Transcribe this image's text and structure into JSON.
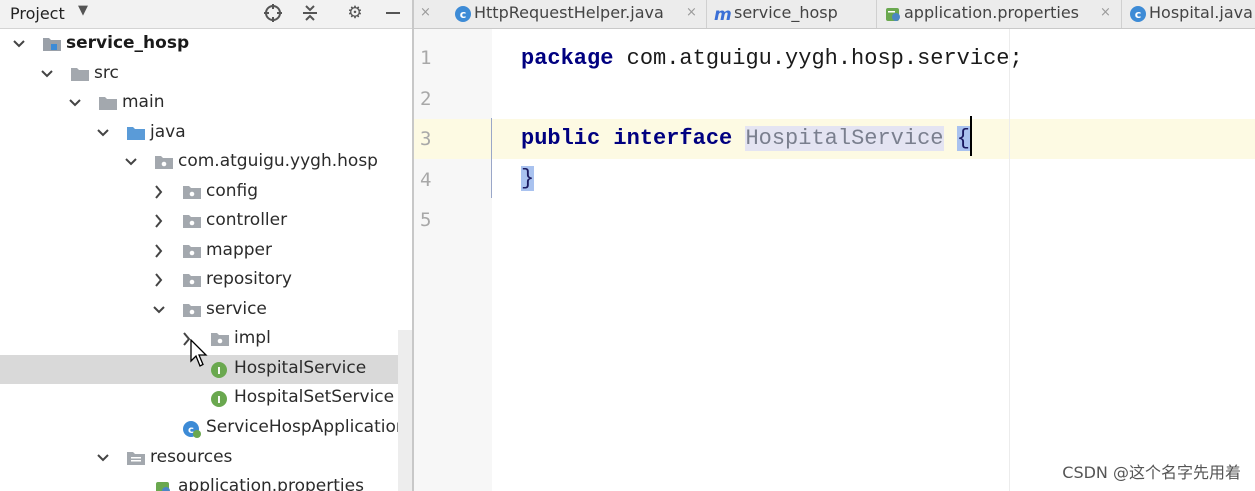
{
  "project_panel": {
    "title": "Project",
    "icons": [
      "crosshair-icon",
      "collapse-icon",
      "gear-icon",
      "minimize-icon"
    ],
    "tree": [
      {
        "label": "service_hosp",
        "icon": "module-folder-icon",
        "expanded": true,
        "bold": true
      },
      {
        "label": "src",
        "icon": "folder-icon",
        "expanded": true
      },
      {
        "label": "main",
        "icon": "folder-icon",
        "expanded": true
      },
      {
        "label": "java",
        "icon": "source-folder-icon",
        "expanded": true
      },
      {
        "label": "com.atguigu.yygh.hosp",
        "icon": "package-icon",
        "expanded": true
      },
      {
        "label": "config",
        "icon": "package-icon",
        "expanded": false
      },
      {
        "label": "controller",
        "icon": "package-icon",
        "expanded": false
      },
      {
        "label": "mapper",
        "icon": "package-icon",
        "expanded": false
      },
      {
        "label": "repository",
        "icon": "package-icon",
        "expanded": false
      },
      {
        "label": "service",
        "icon": "package-icon",
        "expanded": true
      },
      {
        "label": "impl",
        "icon": "package-icon",
        "expanded": false
      },
      {
        "label": "HospitalService",
        "icon": "interface-icon",
        "selected": true
      },
      {
        "label": "HospitalSetService",
        "icon": "interface-icon"
      },
      {
        "label": "ServiceHospApplication",
        "icon": "spring-boot-class-icon"
      },
      {
        "label": "resources",
        "icon": "resources-folder-icon",
        "expanded": true
      },
      {
        "label": "application.properties",
        "icon": "properties-file-icon"
      }
    ]
  },
  "tabs": [
    {
      "label": "HttpRequestHelper.java",
      "icon": "class-icon",
      "close": "×"
    },
    {
      "label": "service_hosp",
      "icon": "maven-icon",
      "close": ""
    },
    {
      "label": "application.properties",
      "icon": "properties-file-icon",
      "close": "×"
    },
    {
      "label": "Hospital.java",
      "icon": "class-icon",
      "close": ""
    }
  ],
  "editor": {
    "line_numbers": [
      "1",
      "2",
      "3",
      "4",
      "5"
    ],
    "lines": {
      "l1_kw": "package",
      "l1_rest": " com.atguigu.yygh.hosp.service;",
      "l3_kw1": "public",
      "l3_kw2": "interface",
      "l3_ident": "HospitalService",
      "l3_brace": "{",
      "l4_brace": "}"
    },
    "current_line": 3
  },
  "watermark": "CSDN @这个名字先用着",
  "colors": {
    "keyword": "#000080",
    "selection": "#d9d9d9",
    "caret_row": "#fdfae3",
    "brace_highlight": "#a9c2ef"
  }
}
